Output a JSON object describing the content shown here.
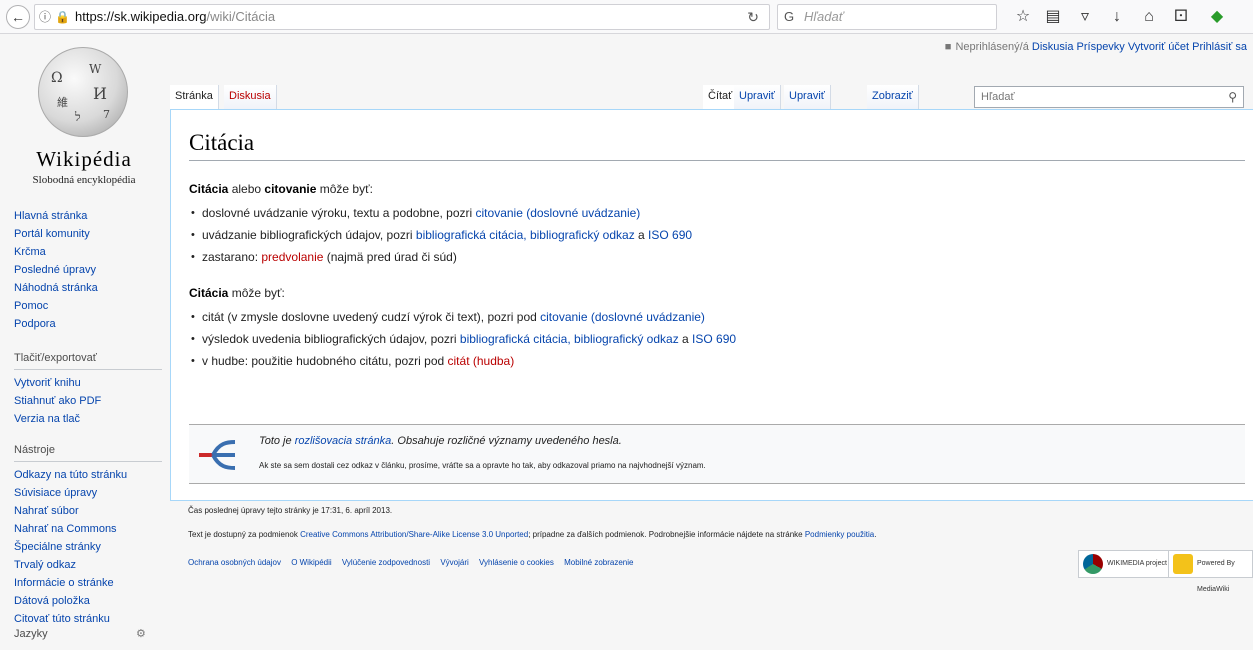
{
  "browser": {
    "url_domain": "https://sk.wikipedia.org",
    "url_path": "/wiki/Citácia",
    "search_placeholder": "Hľadať",
    "icons": [
      "back-arrow",
      "info",
      "lock",
      "reload",
      "star",
      "reading-list",
      "pocket",
      "download",
      "home",
      "extensions",
      "notifications"
    ]
  },
  "personal": {
    "not_logged": "Neprihlásený/á",
    "talk": "Diskusia",
    "contributions": "Príspevky",
    "create_account": "Vytvoriť účet",
    "login": "Prihlásiť sa"
  },
  "logo": {
    "wordmark": "Wikipédia",
    "tagline": "Slobodná encyklopédia"
  },
  "sidebar": {
    "nav": [
      "Hlavná stránka",
      "Portál komunity",
      "Krčma",
      "Posledné úpravy",
      "Náhodná stránka",
      "Pomoc",
      "Podpora"
    ],
    "print_title": "Tlačiť/exportovať",
    "print": [
      "Vytvoriť knihu",
      "Stiahnuť ako PDF",
      "Verzia na tlač"
    ],
    "tools_title": "Nástroje",
    "tools": [
      "Odkazy na túto stránku",
      "Súvisiace úpravy",
      "Nahrať súbor",
      "Nahrať na Commons",
      "Špeciálne stránky",
      "Trvalý odkaz",
      "Informácie o stránke",
      "Dátová položka",
      "Citovať túto stránku"
    ],
    "languages_title": "Jazyky"
  },
  "tabs": {
    "page": "Stránka",
    "discussion": "Diskusia",
    "read": "Čítať",
    "edit": "Upraviť",
    "edit_source": "Upraviť zdroj",
    "history": "Zobraziť históriu",
    "search_placeholder": "Hľadať"
  },
  "article": {
    "title": "Citácia",
    "intro1": {
      "b1": "Citácia",
      "t1": " alebo ",
      "b2": "citovanie",
      "t2": " môže byť:"
    },
    "list1": [
      {
        "text": "doslovné uvádzanie výroku, textu a podobne, pozri ",
        "link": "citovanie (doslovné uvádzanie)"
      },
      {
        "text": "uvádzanie bibliografických údajov, pozri ",
        "link": "bibliografická citácia",
        "sep": ", ",
        "link2": "bibliografický odkaz",
        "mid": " a ",
        "link3": "ISO 690"
      },
      {
        "text": "zastarano: ",
        "link": "predvolanie",
        "after": " (najmä pred úrad či súd)"
      }
    ],
    "intro2": {
      "b1": "Citácia",
      "t1": " môže byť:"
    },
    "list2": [
      {
        "text": "citát (v zmysle doslovne uvedený cudzí výrok či text), pozri pod ",
        "link": "citovanie (doslovné uvádzanie)"
      },
      {
        "text": "výsledok uvedenia bibliografických údajov, pozri ",
        "link": "bibliografická citácia",
        "sep": ", ",
        "link2": "bibliografický odkaz",
        "mid": " a ",
        "link3": "ISO 690"
      },
      {
        "text": "v hudbe: použitie hudobného citátu, pozri pod ",
        "link": "citát (hudba)"
      }
    ],
    "disambig": {
      "pre": "Toto je ",
      "link": "rozlišovacia stránka",
      "post": ". Obsahuje rozličné významy uvedeného hesla.",
      "line2": "Ak ste sa sem dostali cez odkaz v článku, prosíme, vráťte sa a opravte ho tak, aby odkazoval priamo na najvhodnejší význam."
    }
  },
  "footer": {
    "last_edit": "Čas poslednej úpravy tejto stránky je 17:31, 6. apríl 2013.",
    "license_pre": "Text je dostupný za podmienok ",
    "license_link": "Creative Commons Attribution/Share-Alike License 3.0 Unported",
    "license_mid": "; prípadne za ďalších podmienok. Podrobnejšie informácie nájdete na stránke ",
    "license_link2": "Podmienky použitia",
    "license_end": ".",
    "links": [
      "Ochrana osobných údajov",
      "O Wikipédii",
      "Vylúčenie zodpovednosti",
      "Vývojári",
      "Vyhlásenie o cookies",
      "Mobilné zobrazenie"
    ],
    "badge1": "WIKIMEDIA project",
    "badge2": "Powered By MediaWiki"
  }
}
